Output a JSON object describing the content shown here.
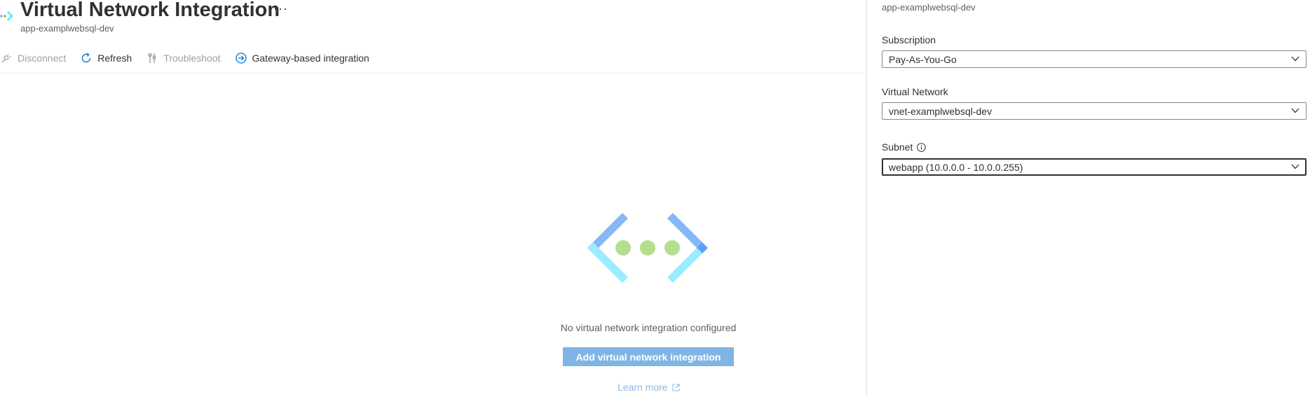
{
  "header": {
    "title": "Virtual Network Integration",
    "more_label": "···",
    "subtitle": "app-examplwebsql-dev"
  },
  "toolbar": {
    "disconnect_label": "Disconnect",
    "refresh_label": "Refresh",
    "troubleshoot_label": "Troubleshoot",
    "gateway_label": "Gateway-based integration"
  },
  "empty_state": {
    "message": "No virtual network integration configured",
    "add_button_label": "Add virtual network integration",
    "learn_more_label": "Learn more"
  },
  "panel": {
    "subtitle": "app-examplwebsql-dev",
    "subscription": {
      "label": "Subscription",
      "value": "Pay-As-You-Go"
    },
    "virtual_network": {
      "label": "Virtual Network",
      "value": "vnet-examplwebsql-dev"
    },
    "subnet": {
      "label": "Subnet",
      "value": "webapp (10.0.0.0 - 10.0.0.255)"
    }
  },
  "colors": {
    "accent": "#0078d4",
    "button_disabled_bg": "#7fb5e5",
    "link_disabled": "#8fb8e0"
  },
  "icons": {
    "page": "vnet-arrow-icon",
    "disconnect": "disconnect-plug-icon",
    "refresh": "refresh-icon",
    "troubleshoot": "troubleshoot-tools-icon",
    "gateway": "gateway-arrow-circle-icon",
    "info": "info-icon",
    "chevron": "chevron-down-icon",
    "external": "external-link-icon"
  }
}
